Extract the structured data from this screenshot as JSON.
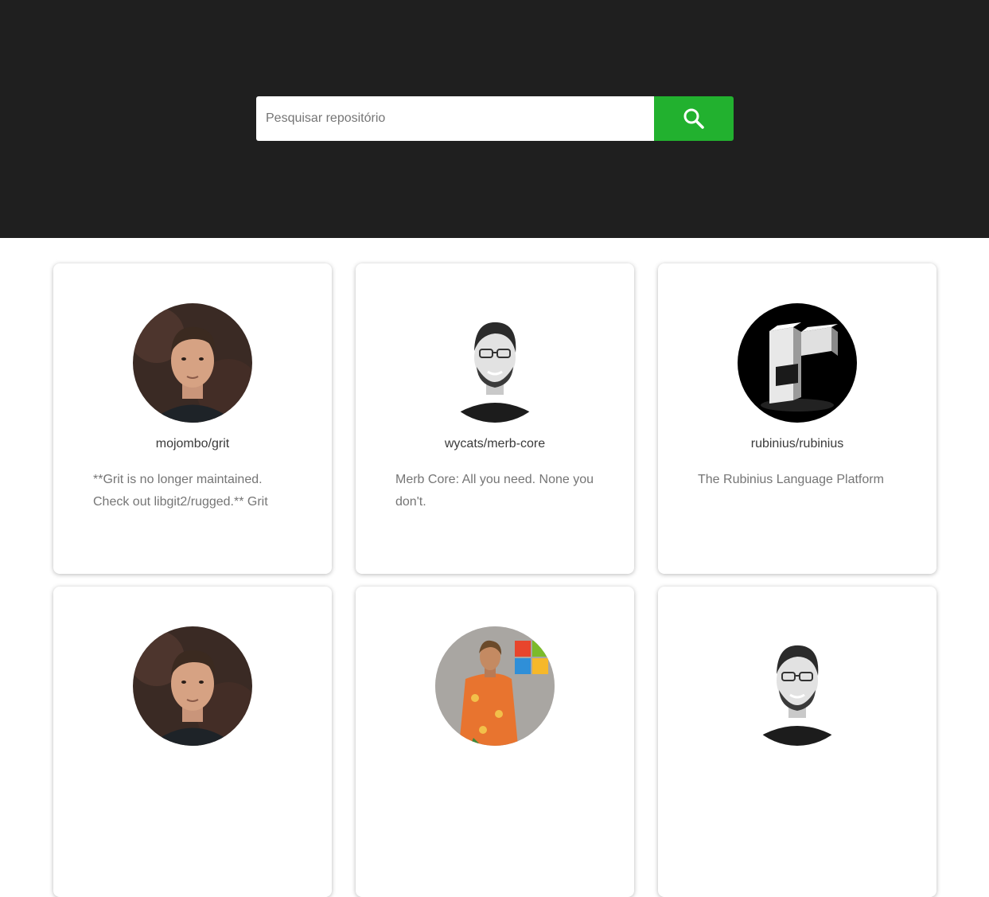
{
  "search": {
    "placeholder": "Pesquisar repositório",
    "button_icon": "search-icon",
    "accent_color": "#22b12f"
  },
  "header": {
    "background": "#1f1f1f"
  },
  "repos": [
    {
      "name": "mojombo/grit",
      "description": "**Grit is no longer maintained. Check out libgit2/rugged.** Grit",
      "avatar": "avatar-photo-man-dark-background"
    },
    {
      "name": "wycats/merb-core",
      "description": "Merb Core: All you need. None you don't.",
      "avatar": "avatar-photo-man-glasses-bw"
    },
    {
      "name": "rubinius/rubinius",
      "description": "The Rubinius Language Platform",
      "avatar": "rubinius-logo"
    },
    {
      "name": "",
      "description": "",
      "avatar": "avatar-photo-man-dark-background"
    },
    {
      "name": "",
      "description": "",
      "avatar": "avatar-photo-man-orange-shirt"
    },
    {
      "name": "",
      "description": "",
      "avatar": "avatar-photo-man-glasses-bw"
    }
  ]
}
